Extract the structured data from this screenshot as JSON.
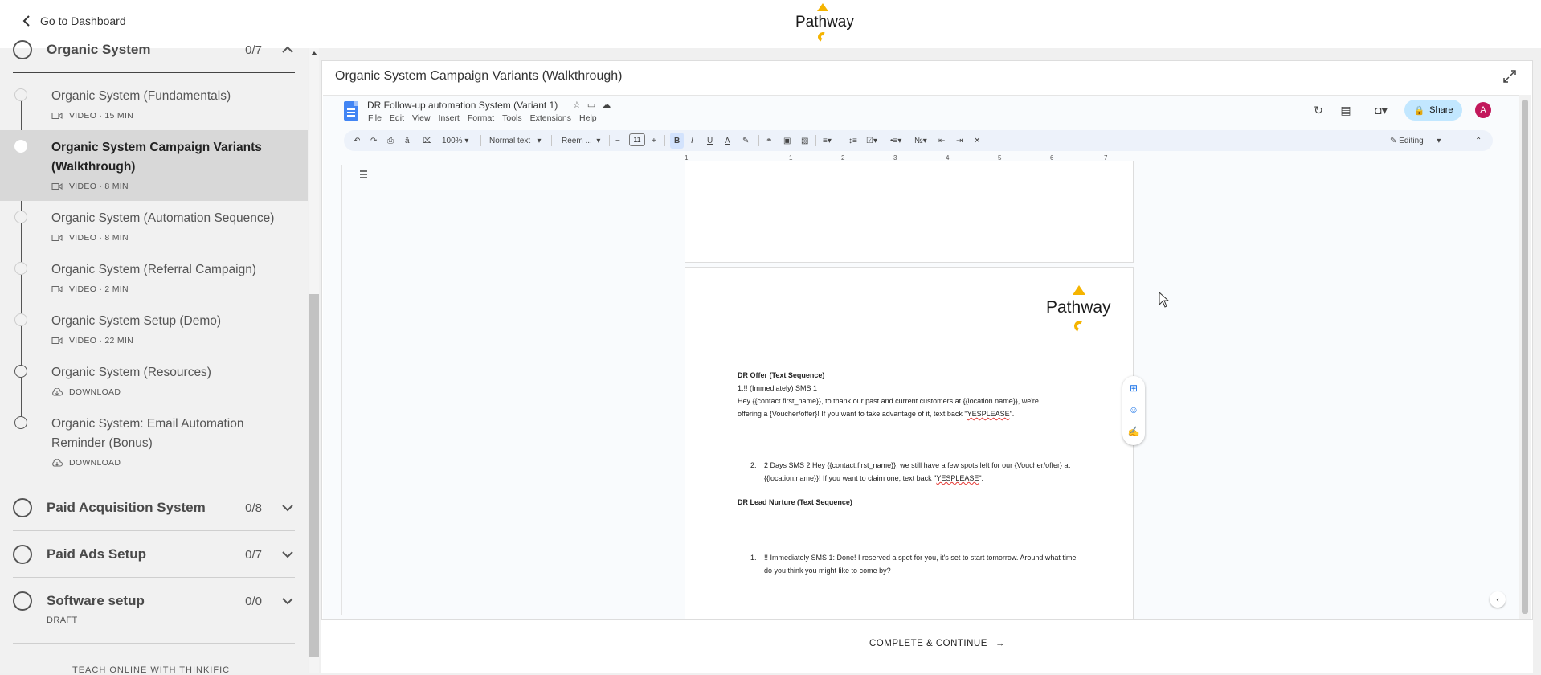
{
  "nav": {
    "back_label": "Go to Dashboard",
    "brand": "Pathway"
  },
  "sidebar": {
    "sections": [
      {
        "title": "Organic System",
        "count": "0/7"
      },
      {
        "title": "Paid Acquisition System",
        "count": "0/8"
      },
      {
        "title": "Paid Ads Setup",
        "count": "0/7"
      },
      {
        "title": "Software setup",
        "count": "0/0",
        "sub": "DRAFT"
      }
    ],
    "lessons": [
      {
        "title": "Organic System (Fundamentals)",
        "meta": "VIDEO · 15 MIN",
        "type": "video"
      },
      {
        "title": "Organic System Campaign Variants (Walkthrough)",
        "meta": "VIDEO · 8 MIN",
        "type": "video"
      },
      {
        "title": "Organic System (Automation Sequence)",
        "meta": "VIDEO · 8 MIN",
        "type": "video"
      },
      {
        "title": "Organic System (Referral Campaign)",
        "meta": "VIDEO · 2 MIN",
        "type": "video"
      },
      {
        "title": "Organic System Setup (Demo)",
        "meta": "VIDEO · 22 MIN",
        "type": "video"
      },
      {
        "title": "Organic System (Resources)",
        "meta": "DOWNLOAD",
        "type": "download"
      },
      {
        "title": "Organic System: Email Automation Reminder (Bonus)",
        "meta": "DOWNLOAD",
        "type": "download"
      }
    ],
    "footer_text": "TEACH ONLINE WITH THINKIFIC"
  },
  "lesson_panel": {
    "title": "Organic System Campaign Variants (Walkthrough)",
    "complete_label": "COMPLETE & CONTINUE",
    "complete_arrow": "→"
  },
  "doc": {
    "title": "DR Follow-up automation System (Variant 1)",
    "menu": [
      "File",
      "Edit",
      "View",
      "Insert",
      "Format",
      "Tools",
      "Extensions",
      "Help"
    ],
    "share_label": "Share",
    "avatar_initial": "A",
    "zoom": "100%",
    "style": "Normal text",
    "font": "Reem ...",
    "font_size": "11",
    "mode": "Editing",
    "ruler_marks": [
      "1",
      "1",
      "2",
      "3",
      "4",
      "5",
      "6",
      "7"
    ],
    "logo": "Pathway",
    "content": {
      "h1": "DR Offer (Text Sequence)",
      "l1": "1.!! (Immediately) SMS 1",
      "l2": "Hey {{contact.first_name}}, to thank our past and current customers at {{location.name}}, we're",
      "l3a": "offering a {Voucher/offer}! If you want to take advantage of it, text back \"",
      "l3b": "YESPLEASE",
      "l3c": "\".",
      "n2": "2.",
      "l4": "2 Days SMS 2 Hey {{contact.first_name}}, we still have a few spots left for our {Voucher/offer} at",
      "l5a": "{{location.name}}! If you want to claim one, text back \"",
      "l5b": "YESPLEASE",
      "l5c": "\".",
      "h2": "DR Lead Nurture (Text Sequence)",
      "n1": "1.",
      "l6": "!! Immediately SMS 1: Done! I reserved a spot for you, it's set to start tomorrow. Around what time",
      "l7": "do you think you might like to come by?"
    }
  },
  "colors": {
    "accent_yellow": "#f5b400",
    "docs_blue": "#4285f4",
    "share_bg": "#c2e7ff",
    "avatar": "#c2185b"
  }
}
